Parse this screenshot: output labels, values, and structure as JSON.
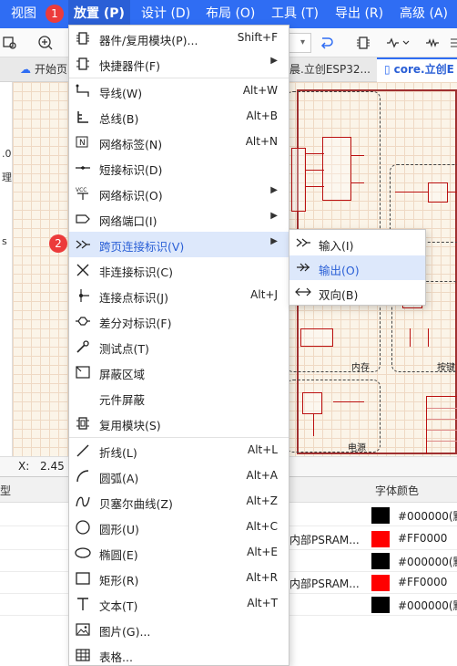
{
  "menubar": {
    "items": [
      "视图",
      "放置 (P)",
      "设计 (D)",
      "布局 (O)",
      "工具 (T)",
      "导出 (R)",
      "高级 (A)"
    ],
    "badge1": "1",
    "badge2": "2"
  },
  "tabs": {
    "items": [
      "开始页",
      "晨.立创ESP32...",
      "core.立创E"
    ]
  },
  "left_panel": {
    "items": [
      ".0",
      "理",
      "s"
    ]
  },
  "canvas": {
    "block_labels": [
      "内存",
      "电源",
      "按键"
    ]
  },
  "coords": {
    "label": "X:",
    "value": "2.45"
  },
  "table": {
    "headers": [
      "型",
      "字体颜色"
    ],
    "rows": [
      {
        "name": "",
        "color": "#000000(默",
        "swatch": "#000000"
      },
      {
        "name": "内部PSRAM...",
        "color": "#FF0000",
        "swatch": "#FF0000"
      },
      {
        "name": "",
        "color": "#000000(默",
        "swatch": "#000000"
      },
      {
        "name": "内部PSRAM...",
        "color": "#FF0000",
        "swatch": "#FF0000"
      },
      {
        "name": "",
        "color": "#000000(默",
        "swatch": "#000000"
      }
    ]
  },
  "menu": {
    "items": [
      {
        "label": "器件/复用模块(P)...",
        "shortcut": "Shift+F",
        "icon": "component-icon"
      },
      {
        "label": "快捷器件(F)",
        "shortcut": "",
        "icon": "quick-component-icon",
        "submenu": true
      },
      {
        "label": "导线(W)",
        "shortcut": "Alt+W",
        "icon": "wire-icon"
      },
      {
        "label": "总线(B)",
        "shortcut": "Alt+B",
        "icon": "bus-icon"
      },
      {
        "label": "网络标签(N)",
        "shortcut": "Alt+N",
        "icon": "net-label-icon"
      },
      {
        "label": "短接标识(D)",
        "shortcut": "",
        "icon": "short-flag-icon"
      },
      {
        "label": "网络标识(O)",
        "shortcut": "",
        "icon": "net-flag-icon",
        "submenu": true
      },
      {
        "label": "网络端口(I)",
        "shortcut": "",
        "icon": "net-port-icon",
        "submenu": true
      },
      {
        "label": "跨页连接标识(V)",
        "shortcut": "",
        "icon": "off-page-connector-icon",
        "submenu": true
      },
      {
        "label": "非连接标识(C)",
        "shortcut": "",
        "icon": "no-connect-icon"
      },
      {
        "label": "连接点标识(J)",
        "shortcut": "Alt+J",
        "icon": "junction-icon"
      },
      {
        "label": "差分对标识(F)",
        "shortcut": "",
        "icon": "diff-pair-icon"
      },
      {
        "label": "测试点(T)",
        "shortcut": "",
        "icon": "test-point-icon"
      },
      {
        "label": "屏蔽区域",
        "shortcut": "",
        "icon": "shield-area-icon"
      },
      {
        "label": "元件屏蔽",
        "shortcut": "",
        "icon": ""
      },
      {
        "label": "复用模块(S)",
        "shortcut": "",
        "icon": "reuse-module-icon"
      },
      {
        "label": "折线(L)",
        "shortcut": "Alt+L",
        "icon": "polyline-icon"
      },
      {
        "label": "圆弧(A)",
        "shortcut": "Alt+A",
        "icon": "arc-icon"
      },
      {
        "label": "贝塞尔曲线(Z)",
        "shortcut": "Alt+Z",
        "icon": "bezier-icon"
      },
      {
        "label": "圆形(U)",
        "shortcut": "Alt+C",
        "icon": "circle-icon"
      },
      {
        "label": "椭圆(E)",
        "shortcut": "Alt+E",
        "icon": "ellipse-icon"
      },
      {
        "label": "矩形(R)",
        "shortcut": "Alt+R",
        "icon": "rectangle-icon"
      },
      {
        "label": "文本(T)",
        "shortcut": "Alt+T",
        "icon": "text-icon"
      },
      {
        "label": "图片(G)...",
        "shortcut": "",
        "icon": "image-icon"
      },
      {
        "label": "表格...",
        "shortcut": "",
        "icon": "table-icon"
      }
    ]
  },
  "submenu": {
    "items": [
      {
        "label": "输入(I)",
        "icon": "input-arrow-icon"
      },
      {
        "label": "输出(O)",
        "icon": "output-arrow-icon"
      },
      {
        "label": "双向(B)",
        "icon": "bidirectional-arrow-icon"
      }
    ]
  }
}
